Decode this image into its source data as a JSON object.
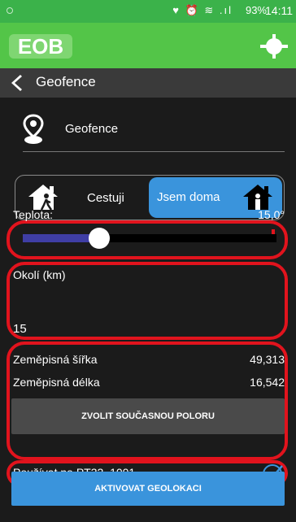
{
  "status_bar": {
    "icons": "♥ ⏰ ≋ .ıl",
    "battery": "93%",
    "time": "14:11"
  },
  "app": {
    "logo_text": "EOB"
  },
  "nav": {
    "title": "Geofence"
  },
  "section": {
    "title": "Geofence"
  },
  "mode_toggle": {
    "travel_label": "Cestuji",
    "home_label": "Jsem doma",
    "selected": "home"
  },
  "temperature": {
    "label": "Teplota:",
    "value": "15,0°",
    "slider_fraction": 0.3
  },
  "radius": {
    "label": "Okolí (km)",
    "value": "15"
  },
  "coordinates": {
    "lat_label": "Zeměpisná šířka",
    "lat_value": "49,313",
    "lon_label": "Zeměpisná délka",
    "lon_value": "16,542",
    "button_label": "ZVOLIT SOUČASNOU POLORU"
  },
  "use_on": {
    "label": "Používat na PT32_1001",
    "checked": true
  },
  "activate_button": {
    "label": "AKTIVOVAT GEOLOKACI"
  },
  "colors": {
    "status_bar": "#3bb24a",
    "app_bar": "#53c548",
    "accent_blue": "#3a94dc",
    "highlight_red": "#e1131d",
    "slider_fill": "#3f3ea5"
  }
}
